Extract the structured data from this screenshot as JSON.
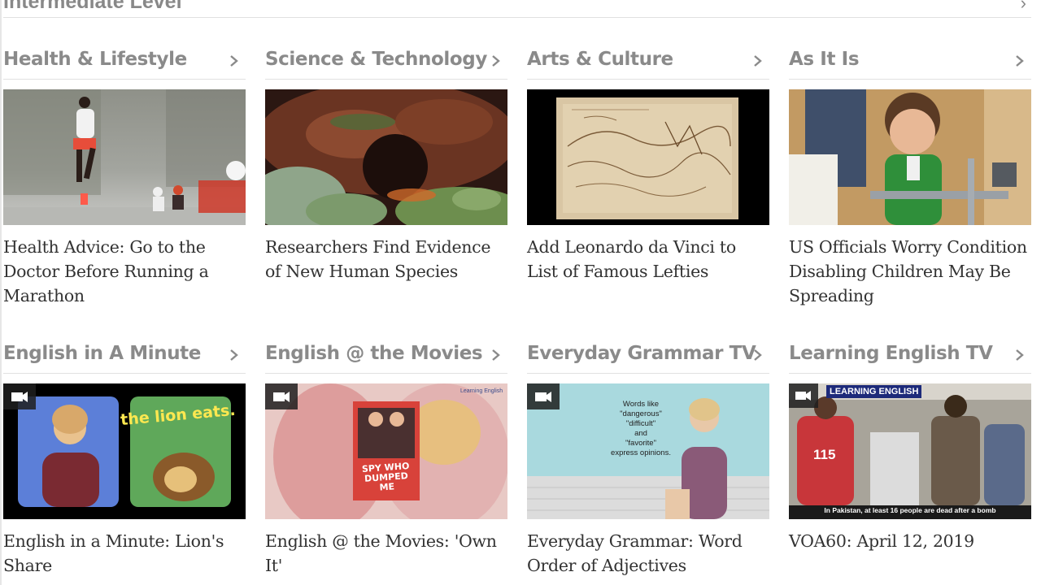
{
  "top_section": {
    "title": "Intermediate Level"
  },
  "row1": [
    {
      "section": "Health & Lifestyle",
      "headline": "Health Advice: Go to the Doctor Before Running a Marathon"
    },
    {
      "section": "Science & Technology",
      "headline": "Researchers Find Evidence of New Human Species"
    },
    {
      "section": "Arts & Culture",
      "headline": "Add Leonardo da Vinci to List of Famous Lefties"
    },
    {
      "section": "As It Is",
      "headline": "US Officials Worry Condition Disabling Children May Be Spreading"
    }
  ],
  "row2": [
    {
      "section": "English in A Minute",
      "headline": "English in a Minute: Lion's Share",
      "thumb_text": "the lion eats."
    },
    {
      "section": "English @ the Movies",
      "headline": "English @ the Movies: 'Own It'",
      "thumb_text": "SPY WHO DUMPED ME",
      "thumb_brand": "Learning English"
    },
    {
      "section": "Everyday Grammar TV",
      "headline": "Everyday Grammar: Word Order of Adjectives",
      "thumb_lines": [
        "Words like",
        "\"dangerous\"",
        "\"difficult\"",
        "and",
        "\"favorite\"",
        "express opinions."
      ]
    },
    {
      "section": "Learning English TV",
      "headline": "VOA60: April 12, 2019",
      "thumb_banner": "LEARNING ENGLISH",
      "thumb_caption": "In Pakistan, at least 16 people are dead after a bomb",
      "thumb_sign": "115"
    }
  ],
  "icons": {
    "chevron": "chevron-right-icon",
    "video": "video-camera-icon"
  },
  "colors": {
    "section_heading": "#8a8a8a",
    "headline": "#333333",
    "divider": "#e1e1e1"
  }
}
